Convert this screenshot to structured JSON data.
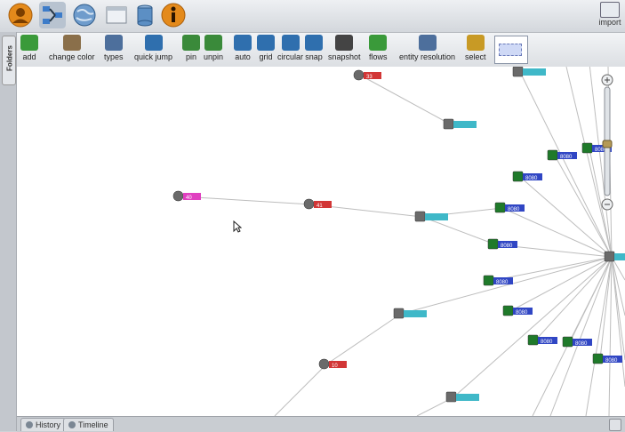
{
  "top_icons": [
    {
      "name": "user-profile-icon",
      "color": "#e48a1b"
    },
    {
      "name": "network-graph-icon",
      "color": "#3d7cc9"
    },
    {
      "name": "globe-icon",
      "color": "#4a7fb5"
    },
    {
      "name": "window-icon",
      "color": "#e8ecf1"
    },
    {
      "name": "database-icon",
      "color": "#5c8fc4"
    },
    {
      "name": "info-icon",
      "color": "#e48a1b"
    }
  ],
  "import_label": "import",
  "toolbar": [
    {
      "label": "add",
      "icon": "plus-icon"
    },
    {
      "label": "change color",
      "icon": "paintbrush-icon"
    },
    {
      "label": "types",
      "icon": "types-icon"
    },
    {
      "label": "quick jump",
      "icon": "quick-jump-icon"
    },
    {
      "label": "pin",
      "icon": "pin-icon"
    },
    {
      "label": "unpin",
      "icon": "unpin-icon"
    },
    {
      "label": "auto",
      "icon": "auto-layout-icon"
    },
    {
      "label": "grid",
      "icon": "grid-layout-icon"
    },
    {
      "label": "circular",
      "icon": "circular-layout-icon"
    },
    {
      "label": "snap",
      "icon": "snap-icon"
    },
    {
      "label": "snapshot",
      "icon": "camera-icon"
    },
    {
      "label": "flows",
      "icon": "flows-icon"
    },
    {
      "label": "entity resolution",
      "icon": "entity-resolution-icon"
    },
    {
      "label": "select",
      "icon": "select-icon"
    }
  ],
  "folders_label": "Folders",
  "graph": {
    "node_labels": {
      "n8080": "8080",
      "n40": "40",
      "n41": "41",
      "n10": "10",
      "n33": "33"
    },
    "colors": {
      "cyan": "#3fb8c8",
      "blue": "#3046c4",
      "pink": "#e040c0",
      "red": "#d23636",
      "edge": "#bdbdbd"
    }
  },
  "bottom_tabs": [
    {
      "label": "History",
      "active": false
    },
    {
      "label": "Timeline",
      "active": true
    }
  ]
}
